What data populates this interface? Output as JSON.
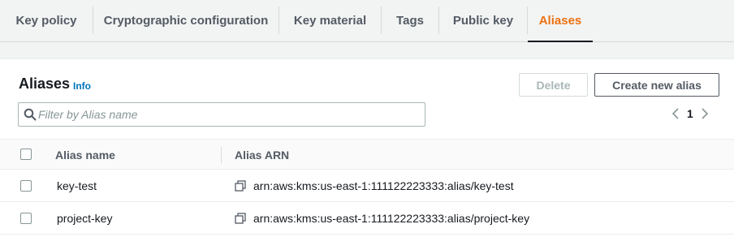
{
  "tabs": [
    {
      "label": "Key policy"
    },
    {
      "label": "Cryptographic configuration"
    },
    {
      "label": "Key material"
    },
    {
      "label": "Tags"
    },
    {
      "label": "Public key"
    },
    {
      "label": "Aliases",
      "active": true
    }
  ],
  "panel": {
    "title": "Aliases",
    "info_label": "Info",
    "delete_label": "Delete",
    "create_label": "Create new alias"
  },
  "search": {
    "placeholder": "Filter by Alias name",
    "value": ""
  },
  "pagination": {
    "current_page": "1"
  },
  "table": {
    "columns": [
      "Alias name",
      "Alias ARN"
    ],
    "rows": [
      {
        "alias_name": "key-test",
        "alias_arn": "arn:aws:kms:us-east-1:111122223333:alias/key-test"
      },
      {
        "alias_name": "project-key",
        "alias_arn": "arn:aws:kms:us-east-1:111122223333:alias/project-key"
      }
    ]
  },
  "colors": {
    "accent": "#ec7211",
    "link": "#0073bb",
    "text": "#16191f",
    "secondary_text": "#545b64",
    "background": "#f2f3f3"
  },
  "icons": {
    "search": "search-icon",
    "copy": "copy-icon",
    "prev": "chevron-left-icon",
    "next": "chevron-right-icon"
  }
}
